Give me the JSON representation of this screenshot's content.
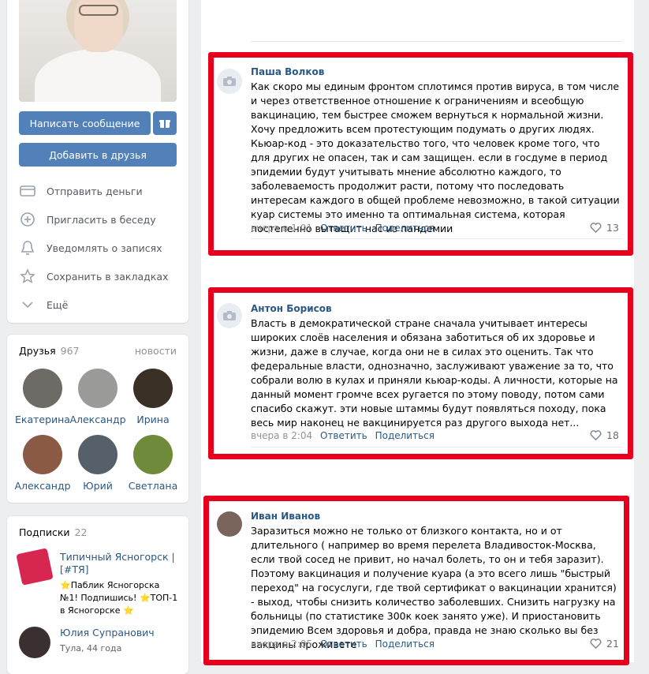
{
  "profile": {
    "message_button": "Написать сообщение",
    "add_friend_button": "Добавить в друзья",
    "actions": [
      {
        "label": "Отправить деньги",
        "icon": "card-icon"
      },
      {
        "label": "Пригласить в беседу",
        "icon": "chat-plus-icon"
      },
      {
        "label": "Уведомлять о записях",
        "icon": "bell-icon"
      },
      {
        "label": "Сохранить в закладках",
        "icon": "star-icon"
      },
      {
        "label": "Ещё",
        "icon": "chevron-down-icon"
      }
    ]
  },
  "friends": {
    "title": "Друзья",
    "count": "967",
    "news_link": "новости",
    "items": [
      {
        "name": "Екатерина",
        "color": "#6e6a66"
      },
      {
        "name": "Александр",
        "color": "#9a9a98"
      },
      {
        "name": "Ирина",
        "color": "#3a3026"
      },
      {
        "name": "Александр",
        "color": "#8a5a45"
      },
      {
        "name": "Юрий",
        "color": "#55606b"
      },
      {
        "name": "Светлана",
        "color": "#6f8a3a"
      }
    ]
  },
  "subscriptions": {
    "title": "Подписки",
    "count": "22",
    "items": [
      {
        "name": "Типичный Ясногорск | [#ТЯ]",
        "desc": "⭐Паблик Ясногорска №1! Подпишись! ⭐ТОП-1 в Ясногорске ⭐",
        "color": "#d7264f"
      },
      {
        "name": "Юлия Супранович",
        "desc": "Тула, 44 года",
        "color": "#3a3030"
      }
    ]
  },
  "comments": [
    {
      "author": "Паша Волков",
      "text": "Как скоро мы единым фронтом сплотимся против вируса, в том числе и через ответственное отношение к ограничениям и всеобщую вакцинацию, тем быстрее сможем вернуться к нормальной жизни. Хочу предложить всем протестующим подумать о других людях. Кьюар-код - это доказательство того, что человек кроме того, что для других не опасен, так и сам защищен. если в госдуме в период эпидемии будут учитывать мнение абсолютно каждого, то заболеваемость продолжит расти, потому что последовать интересам каждого в общей проблеме невозможно, в такой ситуации куар системы это именно та оптимальная система, которая постепенно вытащит нас из пандемии",
      "time": "вчера в 1:01",
      "reply": "Ответить",
      "share": "Поделиться",
      "likes": "13"
    },
    {
      "author": "Антон Борисов",
      "text": "Власть в демократической стране сначала учитывает интересы широких слоёв населения и обязана заботиться об их здоровье и жизни, даже в случае, когда они не в силах это оценить. Так что федеральные власти, однозначно, заслуживают уважение за то, что собрали волю в кулах и приняли кьюар-коды. А личности, которые на данный момент громче всех ругается по этому поводу, потом сами спасибо скажут. эти новые штаммы будут появляться походу, пока весь мир наконец не вакцинируется раз другого выхода нет...",
      "time": "вчера в 2:04",
      "reply": "Ответить",
      "share": "Поделиться",
      "likes": "18"
    },
    {
      "author": "Иван Иванов",
      "text": "Заразиться можно не только от близкого контакта, но и от длительного ( например во время перелета Владивосток-Москва, если твой сосед не привит, но начал болеть, то он и тебя заразит). Поэтому вакцинация и получение куара (а это всего лишь \"быстрый переход\" на госуслуги, где твой сертификат о вакцинации хранится) - выход, чтобы снизить количество заболевших. Снизить нагрузку на больницы (по статистике 300к коек занято уже). И приостановить эпидемию Всем здоровья и добра, правда не знаю сколько вы без вакцины проживете",
      "time": "вчера в 2:05",
      "reply": "Ответить",
      "share": "Поделиться",
      "likes": "21"
    }
  ],
  "colors": {
    "accent": "#5181b8",
    "link": "#2a5885",
    "highlight": "#e6001e"
  }
}
